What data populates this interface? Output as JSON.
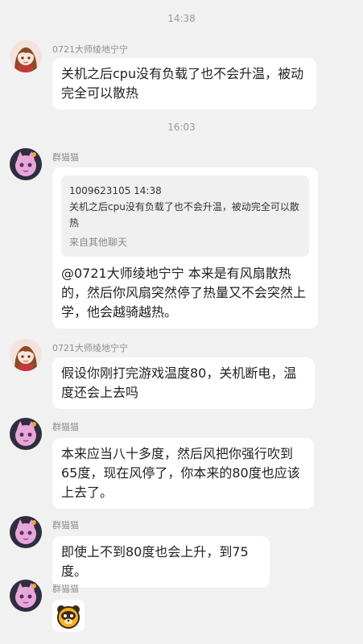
{
  "timestamps": [
    "14:38",
    "16:03"
  ],
  "messages": [
    {
      "sender": "0721大师绫地宁宁",
      "text": "关机之后cpu没有负载了也不会升温，被动完全可以散热"
    },
    {
      "sender": "群猫猫",
      "quote": {
        "header": "1009623105 14:38",
        "text": "关机之后cpu没有负载了也不会升温，被动完全可以散热",
        "source": "来自其他聊天"
      },
      "text": "@0721大师绫地宁宁 本来是有风扇散热的，然后你风扇突然停了热量又不会突然上学，他会越骑越热。"
    },
    {
      "sender": "0721大师绫地宁宁",
      "text": "假设你刚打完游戏温度80，关机断电，温度还会上去吗"
    },
    {
      "sender": "群猫猫",
      "text": "本来应当八十多度，然后风把你强行吹到65度，现在风停了，你本来的80度也应该上去了。"
    },
    {
      "sender": "群猫猫",
      "text": "即使上不到80度也会上升，到75度。"
    },
    {
      "sender": "群猫猫",
      "emoji": "yellow-bear-emoji"
    }
  ],
  "colors": {
    "background": "#f1f1f1",
    "bubble": "#ffffff",
    "quote_bg": "#f0f0f0",
    "text": "#222222",
    "meta": "#8f8f8f"
  }
}
